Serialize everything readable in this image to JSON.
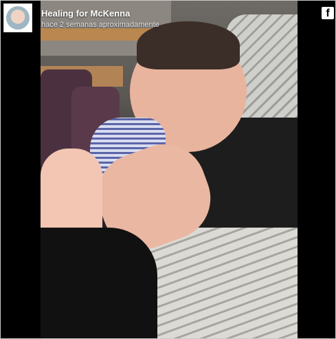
{
  "post": {
    "author": "Healing for McKenna",
    "timestamp": "hace 2 semanas aproximadamente"
  },
  "icons": {
    "avatar": "avatar-thumbnail",
    "facebook": "facebook-icon",
    "facebook_glyph": "f"
  },
  "colors": {
    "background": "#000000",
    "text": "#ffffff"
  }
}
